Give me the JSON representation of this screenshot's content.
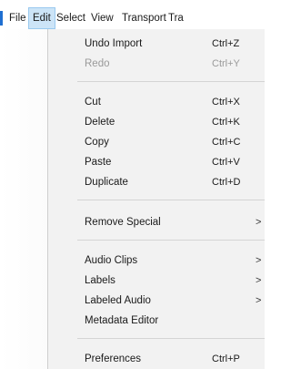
{
  "menubar": {
    "items": [
      {
        "label": "File"
      },
      {
        "label": "Edit",
        "active": true
      },
      {
        "label": "Select"
      },
      {
        "label": "View"
      },
      {
        "label": "Transport"
      },
      {
        "label": "Tra"
      }
    ]
  },
  "edit_menu": {
    "items": [
      {
        "label": "Undo Import",
        "shortcut": "Ctrl+Z",
        "enabled": true
      },
      {
        "label": "Redo",
        "shortcut": "Ctrl+Y",
        "enabled": false
      },
      {
        "label": "Cut",
        "shortcut": "Ctrl+X",
        "enabled": true
      },
      {
        "label": "Delete",
        "shortcut": "Ctrl+K",
        "enabled": true
      },
      {
        "label": "Copy",
        "shortcut": "Ctrl+C",
        "enabled": true
      },
      {
        "label": "Paste",
        "shortcut": "Ctrl+V",
        "enabled": true
      },
      {
        "label": "Duplicate",
        "shortcut": "Ctrl+D",
        "enabled": true
      },
      {
        "label": "Remove Special",
        "submenu_icon": "chevron-right-icon",
        "submenu_glyph": ">",
        "enabled": true
      },
      {
        "label": "Audio Clips",
        "submenu_icon": "chevron-right-icon",
        "submenu_glyph": ">",
        "enabled": true
      },
      {
        "label": "Labels",
        "submenu_icon": "chevron-right-icon",
        "submenu_glyph": ">",
        "enabled": true
      },
      {
        "label": "Labeled Audio",
        "submenu_icon": "chevron-right-icon",
        "submenu_glyph": ">",
        "enabled": true
      },
      {
        "label": "Metadata Editor",
        "enabled": true
      },
      {
        "label": "Preferences",
        "shortcut": "Ctrl+P",
        "enabled": true
      }
    ]
  },
  "colors": {
    "active_menu_bg": "#cce4f7",
    "active_menu_border": "#99c9ef",
    "menu_bg": "#f2f2f2",
    "disabled_text": "#9a9a9a"
  }
}
